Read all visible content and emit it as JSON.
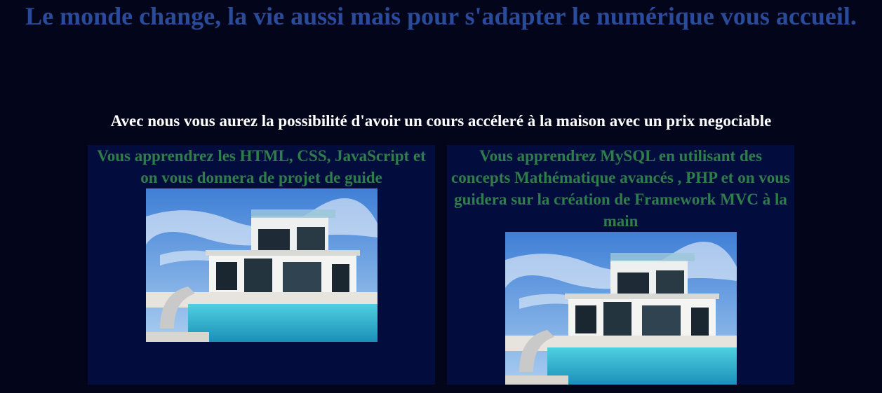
{
  "header": {
    "title": "Le monde change, la vie aussi mais pour s'adapter le numérique vous accueil."
  },
  "intro": {
    "text": "Avec nous vous aurez la possibilité d'avoir un cours accéleré à la maison avec un prix negociable"
  },
  "cards": [
    {
      "text": "Vous apprendrez les HTML, CSS, JavaScript et on vous donnera de projet de guide",
      "image": "modern-villa-with-pool-photo"
    },
    {
      "text": "Vous apprendrez MySQL en utilisant des concepts Mathématique avancés , PHP et on vous guidera sur la création de Framework MVC à la main",
      "image": "modern-villa-with-pool-photo"
    }
  ],
  "colors": {
    "background": "#03051a",
    "title": "#2a4a9a",
    "card_background": "#020d3d",
    "card_text": "#2e7d4a"
  }
}
